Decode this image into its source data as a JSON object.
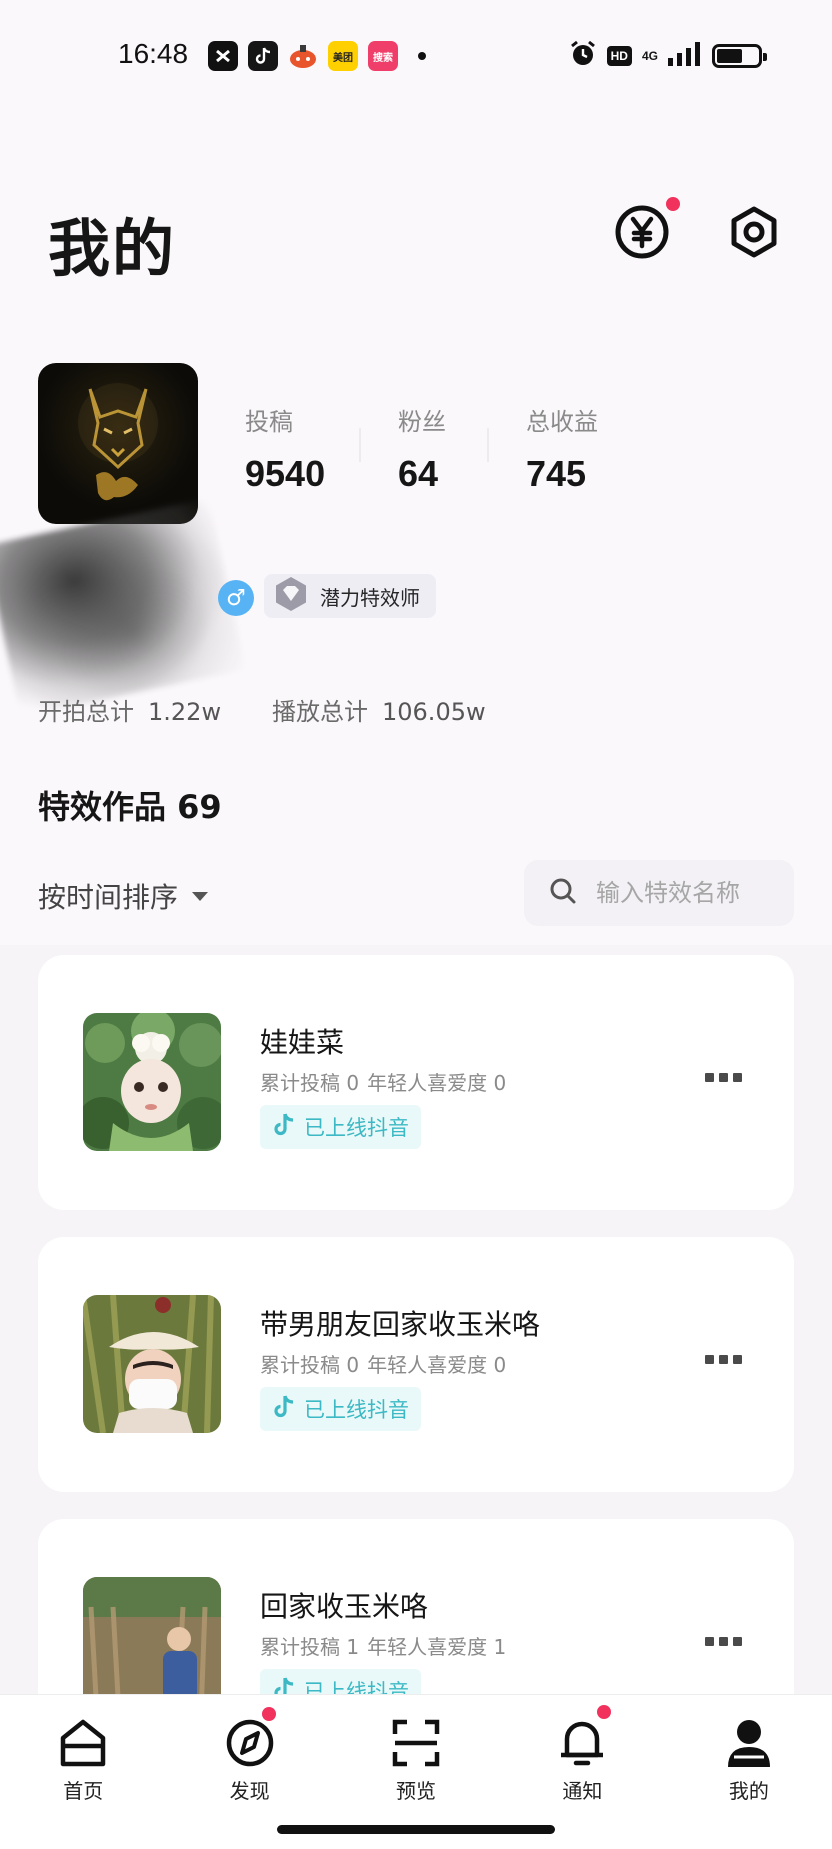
{
  "status_bar": {
    "time": "16:48",
    "apps": [
      {
        "name": "capcut-icon",
        "color": "#111111"
      },
      {
        "name": "douyin-icon",
        "color": "#161616"
      },
      {
        "name": "game-icon",
        "color": "#e8542c"
      },
      {
        "name": "meituan-icon",
        "color": "#ffd000",
        "text": "美团"
      },
      {
        "name": "search-app-icon",
        "color": "#ef3e6a",
        "text": "搜索"
      }
    ],
    "hd_label": "HD",
    "network": "4G"
  },
  "header": {
    "title": "我的"
  },
  "profile": {
    "stats": [
      {
        "label": "投稿",
        "value": "9540"
      },
      {
        "label": "粉丝",
        "value": "64"
      },
      {
        "label": "总收益",
        "value": "745"
      }
    ],
    "gender_symbol": "♂",
    "title_badge": "潜力特效师",
    "totals": [
      {
        "label": "开拍总计",
        "value": "1.22w"
      },
      {
        "label": "播放总计",
        "value": "106.05w"
      }
    ]
  },
  "works": {
    "title": "特效作品 69",
    "sort_label": "按时间排序",
    "search_placeholder": "输入特效名称"
  },
  "cards": [
    {
      "name": "娃娃菜",
      "submissions": "累计投稿 0",
      "popularity": "年轻人喜爱度 0",
      "status": "已上线抖音"
    },
    {
      "name": "带男朋友回家收玉米咯",
      "submissions": "累计投稿 0",
      "popularity": "年轻人喜爱度 0",
      "status": "已上线抖音"
    },
    {
      "name": "回家收玉米咯",
      "submissions": "累计投稿 1",
      "popularity": "年轻人喜爱度 1",
      "status": "已上线抖音"
    }
  ],
  "bottom_nav": [
    {
      "label": "首页",
      "icon": "home-icon"
    },
    {
      "label": "发现",
      "icon": "compass-icon",
      "badge": true
    },
    {
      "label": "预览",
      "icon": "scan-icon"
    },
    {
      "label": "通知",
      "icon": "bell-icon",
      "badge": true
    },
    {
      "label": "我的",
      "icon": "user-icon",
      "active": true
    }
  ],
  "colors": {
    "accent_red": "#f0325d",
    "online_teal": "#3cb9c4",
    "background": "#f6f4f7"
  }
}
